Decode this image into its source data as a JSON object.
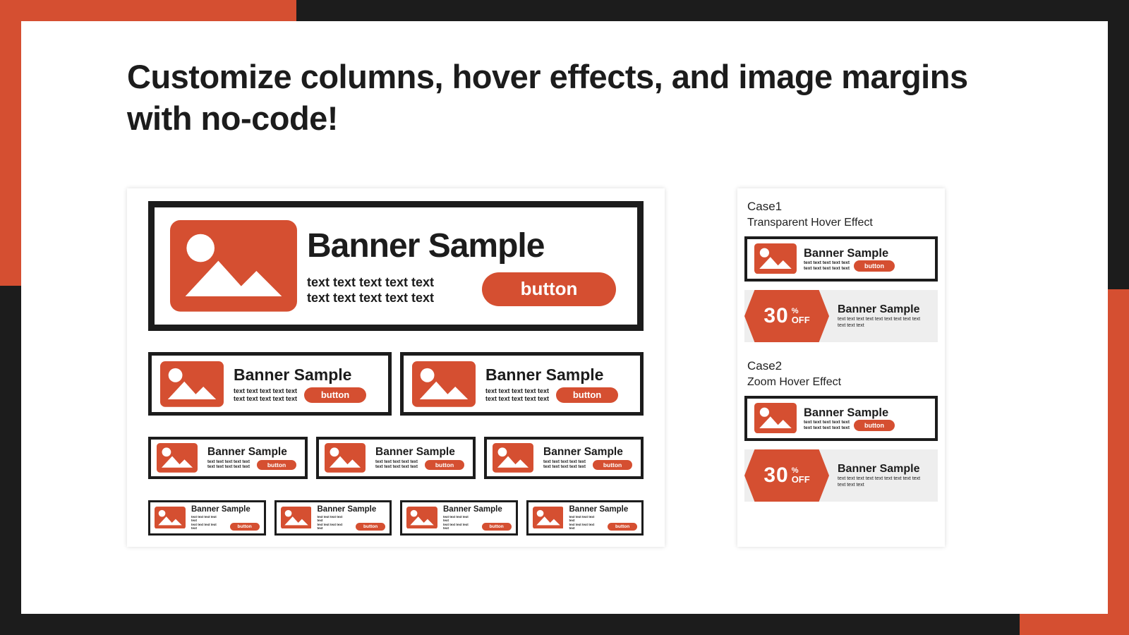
{
  "headline": "Customize columns, hover effects, and image margins with no-code!",
  "banner": {
    "title": "Banner Sample",
    "line1": "text text text text text",
    "line2": "text text text text text",
    "button": "button"
  },
  "promo": {
    "number": "30",
    "percent": "%",
    "off": "OFF",
    "title": "Banner Sample",
    "line1": "text text text text text text text text text",
    "line2": "text text text"
  },
  "sidebar": {
    "case1_label": "Case1",
    "case1_sub": "Transparent Hover Effect",
    "case2_label": "Case2",
    "case2_sub": "Zoom Hover Effect"
  }
}
